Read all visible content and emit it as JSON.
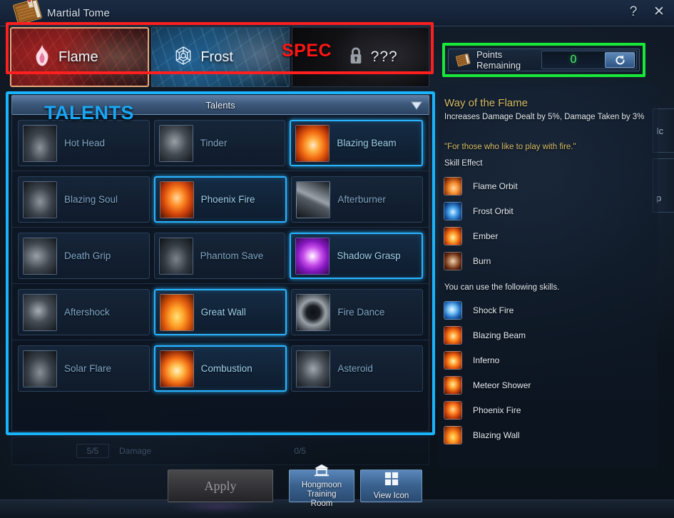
{
  "window": {
    "title": "Martial Tome",
    "book_icon": "tome-icon",
    "help_label": "?",
    "close_label": "✕"
  },
  "annotations": {
    "spec_label": "SPEC",
    "spec_color": "#ff1515",
    "talents_label": "TALENTS",
    "talents_color": "#19a7f5",
    "points_box_color": "#18e838",
    "spec_box_color": "#ff1f1f",
    "talents_box_color": "#18b4ff"
  },
  "spec_tabs": [
    {
      "label": "Flame",
      "icon": "flame-icon",
      "selected": true,
      "locked": false
    },
    {
      "label": "Frost",
      "icon": "snowflake-icon",
      "selected": false,
      "locked": false
    },
    {
      "label": "???",
      "icon": "lock-icon",
      "selected": false,
      "locked": true
    }
  ],
  "points": {
    "icon": "tome-icon",
    "label": "Points Remaining",
    "value": "0",
    "value_color": "#4ef06a",
    "reset_icon": "reset-arrow-icon"
  },
  "talents": {
    "header_label": "Talents",
    "caret_icon": "chevron-down-icon",
    "rows": [
      [
        {
          "name": "Hot Head",
          "selected": false,
          "art": "grey-hands"
        },
        {
          "name": "Tinder",
          "selected": false,
          "art": "grey-figure"
        },
        {
          "name": "Blazing Beam",
          "selected": true,
          "art": "fire-hand"
        }
      ],
      [
        {
          "name": "Blazing Soul",
          "selected": false,
          "art": "grey-monk"
        },
        {
          "name": "Phoenix Fire",
          "selected": true,
          "art": "fire-body"
        },
        {
          "name": "Afterburner",
          "selected": false,
          "art": "grey-streak"
        }
      ],
      [
        {
          "name": "Death Grip",
          "selected": false,
          "art": "grey-claw"
        },
        {
          "name": "Phantom Save",
          "selected": false,
          "art": "grey-meditate"
        },
        {
          "name": "Shadow Grasp",
          "selected": true,
          "art": "purple-vortex"
        }
      ],
      [
        {
          "name": "Aftershock",
          "selected": false,
          "art": "grey-shock"
        },
        {
          "name": "Great Wall",
          "selected": true,
          "art": "fire-wall"
        },
        {
          "name": "Fire Dance",
          "selected": false,
          "art": "grey-burst"
        }
      ],
      [
        {
          "name": "Solar Flare",
          "selected": false,
          "art": "grey-stance"
        },
        {
          "name": "Combustion",
          "selected": true,
          "art": "fire-burst"
        },
        {
          "name": "Asteroid",
          "selected": false,
          "art": "grey-torso"
        }
      ]
    ],
    "ghost_row": {
      "left_value": "5/5",
      "label": "Damage",
      "right_value": "0/5"
    }
  },
  "buttons": {
    "apply": "Apply",
    "hongmoon_line1": "Hongmoon Training",
    "hongmoon_line2": "Room",
    "hongmoon_icon": "training-room-icon",
    "view_icon_label": "View Icon",
    "view_icon_glyph": "grid-icon"
  },
  "info": {
    "title": "Way of the Flame",
    "subtitle": "Increases Damage Dealt by 5%, Damage Taken by 3%",
    "quote": "\"For those who like to play with fire.\"",
    "skill_effect_label": "Skill Effect",
    "skill_effects": [
      {
        "name": "Flame Orbit",
        "art": "orbit-fire"
      },
      {
        "name": "Frost Orbit",
        "art": "orbit-frost"
      },
      {
        "name": "Ember",
        "art": "ember"
      },
      {
        "name": "Burn",
        "art": "burn"
      }
    ],
    "usable_note": "You can use the following skills.",
    "usable_skills": [
      {
        "name": "Shock Fire",
        "art": "shock"
      },
      {
        "name": "Blazing Beam",
        "art": "fire-hand"
      },
      {
        "name": "Inferno",
        "art": "inferno"
      },
      {
        "name": "Meteor Shower",
        "art": "meteor"
      },
      {
        "name": "Phoenix Fire",
        "art": "fire-body"
      },
      {
        "name": "Blazing Wall",
        "art": "fire-wall"
      }
    ]
  },
  "background_edge": {
    "label_1": "Ic",
    "label_2": "p"
  }
}
